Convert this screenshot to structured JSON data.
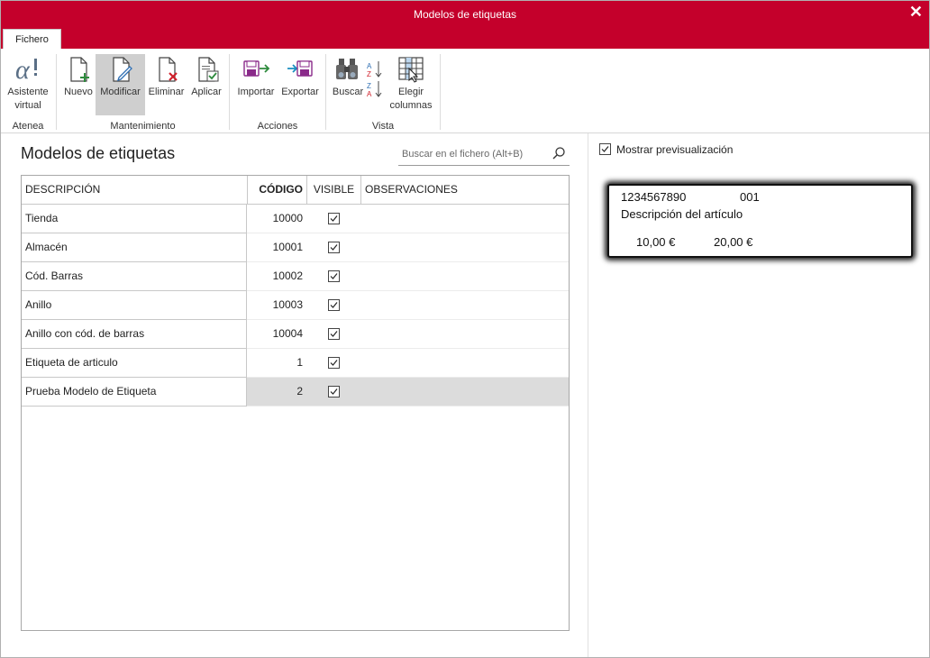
{
  "window": {
    "title": "Modelos de etiquetas",
    "close_symbol": "✕"
  },
  "ribbon": {
    "tab": "Fichero",
    "groups": {
      "atenea": {
        "title": "Atenea",
        "asistente": "Asistente virtual"
      },
      "mantenimiento": {
        "title": "Mantenimiento",
        "nuevo": "Nuevo",
        "modificar": "Modificar",
        "eliminar": "Eliminar",
        "aplicar": "Aplicar"
      },
      "acciones": {
        "title": "Acciones",
        "importar": "Importar",
        "exportar": "Exportar"
      },
      "vista": {
        "title": "Vista",
        "buscar": "Buscar",
        "elegir_columnas": "Elegir columnas"
      }
    }
  },
  "main": {
    "heading": "Modelos de etiquetas",
    "search_placeholder": "Buscar en el fichero (Alt+B)",
    "columns": [
      "DESCRIPCIÓN",
      "CÓDIGO",
      "VISIBLE",
      "OBSERVACIONES"
    ],
    "rows": [
      {
        "descripcion": "Tienda",
        "codigo": "10000",
        "visible": true,
        "observaciones": ""
      },
      {
        "descripcion": "Almacén",
        "codigo": "10001",
        "visible": true,
        "observaciones": ""
      },
      {
        "descripcion": "Cód. Barras",
        "codigo": "10002",
        "visible": true,
        "observaciones": ""
      },
      {
        "descripcion": "Anillo",
        "codigo": "10003",
        "visible": true,
        "observaciones": ""
      },
      {
        "descripcion": "Anillo con cód. de barras",
        "codigo": "10004",
        "visible": true,
        "observaciones": ""
      },
      {
        "descripcion": "Etiqueta de articulo",
        "codigo": "1",
        "visible": true,
        "observaciones": ""
      },
      {
        "descripcion": "Prueba Modelo de Etiqueta",
        "codigo": "2",
        "visible": true,
        "observaciones": "",
        "selected": true
      }
    ]
  },
  "preview": {
    "toggle_label": "Mostrar previsualización",
    "toggle_checked": true,
    "label": {
      "codigo": "1234567890",
      "numero": "001",
      "descripcion": "Descripción del artículo",
      "precio1": "10,00 €",
      "precio2": "20,00 €"
    }
  },
  "colors": {
    "accent": "#c4002b",
    "selected_row": "#dcdcdc",
    "active_button": "#cfcfcf"
  }
}
